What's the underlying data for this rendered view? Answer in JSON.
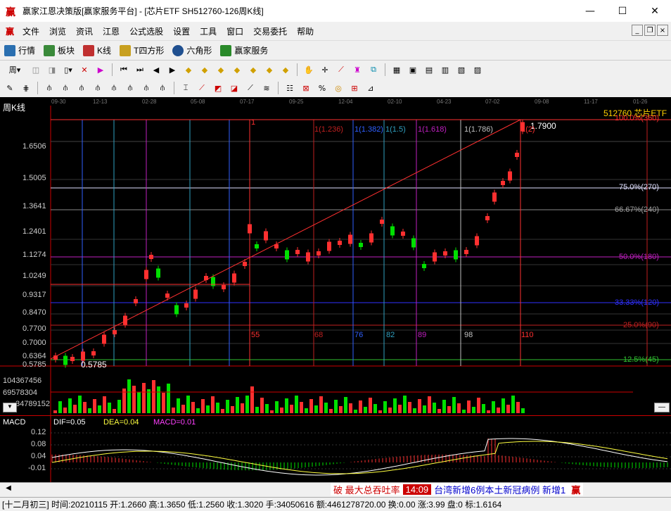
{
  "window": {
    "title": "赢家江恩决策版[赢家服务平台] - [芯片ETF  SH512760-126周K线]",
    "logo": "赢"
  },
  "menu": [
    "文件",
    "浏览",
    "资讯",
    "江恩",
    "公式选股",
    "设置",
    "工具",
    "窗口",
    "交易委托",
    "帮助"
  ],
  "quickbar": [
    {
      "label": "行情",
      "color": "#2a6fb0"
    },
    {
      "label": "板块",
      "color": "#3a8a3a"
    },
    {
      "label": "K线",
      "color": "#c03030"
    },
    {
      "label": "T四方形",
      "color": "#c8a020"
    },
    {
      "label": "六角形",
      "color": "#205090"
    },
    {
      "label": "赢家服务",
      "color": "#2a8a2a"
    }
  ],
  "period_selector": "周",
  "dates": [
    "09-30",
    "12-13",
    "02-28",
    "05-08",
    "07-17",
    "09-25",
    "12-04",
    "02-10",
    "04-23",
    "07-02",
    "09-08",
    "11-17",
    "01-26"
  ],
  "chart": {
    "panel_label": "周K线",
    "instrument": "512760 芯片ETF",
    "y_ticks": [
      "1.6506",
      "1.5005",
      "1.3641",
      "1.2401",
      "1.1274",
      "1.0249",
      "0.9317",
      "0.8470",
      "0.7700",
      "0.7000",
      "0.6364",
      "0.5785"
    ],
    "high_label": "1.7900",
    "low_label": "0.5785",
    "levels": [
      {
        "label": "100.0%(360)",
        "color": "#ff3030"
      },
      {
        "label": "75.0%(270)",
        "color": "#e0e0ff"
      },
      {
        "label": "66.67%(240)",
        "color": "#a0a0a0"
      },
      {
        "label": "50.0%(180)",
        "color": "#c020c0"
      },
      {
        "label": "33.33%(120)",
        "color": "#3030ff"
      },
      {
        "label": "25.0%(90)",
        "color": "#c02020"
      },
      {
        "label": "12.5%(45)",
        "color": "#30c030"
      }
    ],
    "time_lines": [
      {
        "label": "1",
        "color": "#ff3030"
      },
      {
        "label": "1(1.236)",
        "color": "#c02020"
      },
      {
        "label": "1(1.382)",
        "color": "#3060ff"
      },
      {
        "label": "1(1.5)",
        "color": "#30a0c0"
      },
      {
        "label": "1(1.618)",
        "color": "#c020c0"
      },
      {
        "label": "1(1.786)",
        "color": "#c0c0c0"
      },
      {
        "label": "1(2)",
        "color": "#ff3030"
      }
    ],
    "bar_counts": [
      "55",
      "68",
      "76",
      "82",
      "89",
      "98",
      "110"
    ],
    "volume_ticks": [
      "104367456",
      "69578304",
      "34789152"
    ]
  },
  "macd": {
    "title": "MACD",
    "dif": "DIF=0.05",
    "dea": "DEA=0.04",
    "macd": "MACD=0.01",
    "y_ticks": [
      "0.12",
      "0.08",
      "0.04",
      "-0.01"
    ]
  },
  "news": {
    "n1": "破 最大总吞吐率",
    "time": "14:09",
    "n3": "台湾新增6例本土新冠病例 新增1"
  },
  "status": "[十二月初三] 时间:20210115 开:1.2660 高:1.3650 低:1.2560 收:1.3020 手:34050616 额:4461278720.00 换:0.00 涨:3.99 盘:0 标:1.6164",
  "colors": {
    "up": "#ff3030",
    "down": "#00e000",
    "ma": "#ffff40"
  }
}
